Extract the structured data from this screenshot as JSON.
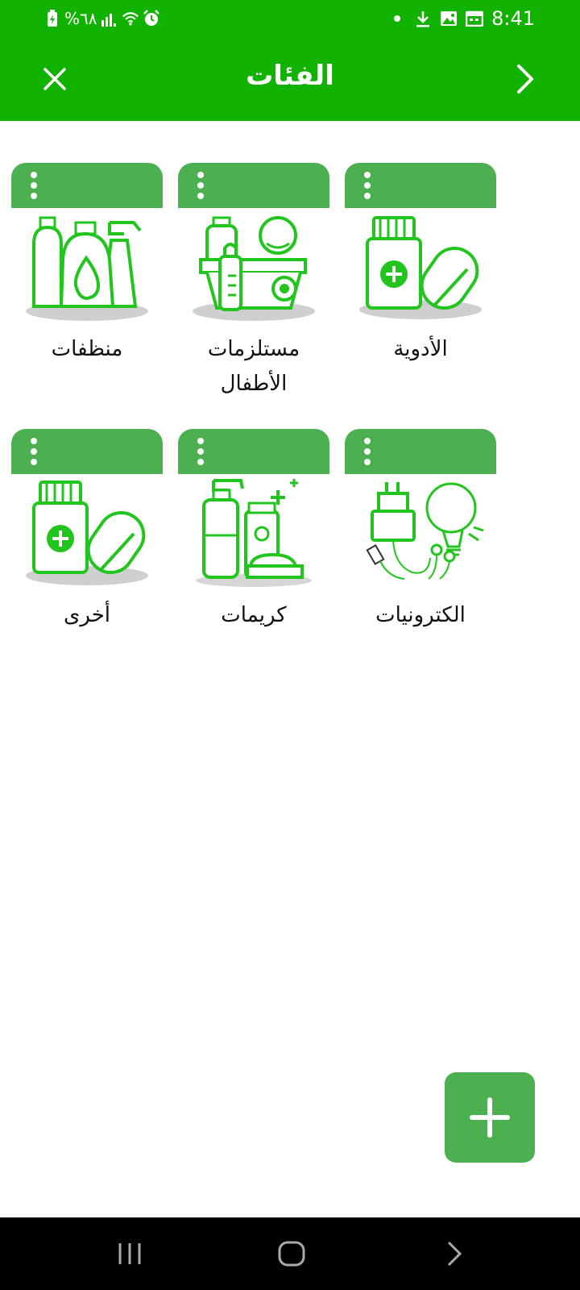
{
  "status_bar": {
    "battery_text": "%٦٨",
    "time": "8:41",
    "left_icons": [
      "battery-charging-icon",
      "signal-icon",
      "wifi-icon",
      "alarm-icon"
    ],
    "right_icons": [
      "dot-icon",
      "download-icon",
      "image-icon",
      "calendar-icon"
    ]
  },
  "app_bar": {
    "title": "الفئات",
    "left_icon": "close-icon",
    "right_icon": "chevron-right-icon"
  },
  "categories": [
    {
      "label": "الأدوية",
      "icon": "medicine-icon"
    },
    {
      "label": "مستلزمات الأطفال",
      "icon": "baby-supplies-icon"
    },
    {
      "label": "منظفات",
      "icon": "detergents-icon"
    },
    {
      "label": "الكترونيات",
      "icon": "electronics-icon"
    },
    {
      "label": "كريمات",
      "icon": "creams-icon"
    },
    {
      "label": "أخرى",
      "icon": "other-icon"
    }
  ],
  "fab": {
    "icon": "plus-icon"
  },
  "nav_bar": {
    "icons": [
      "recent-apps-icon",
      "home-icon",
      "back-icon"
    ]
  },
  "colors": {
    "primary": "#12b200",
    "card_header": "#4caf50",
    "icon_green": "#22c51e",
    "nav_bar": "#000000"
  }
}
